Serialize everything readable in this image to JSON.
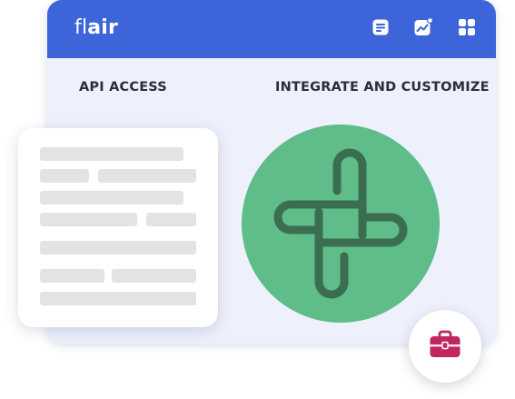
{
  "app": {
    "logo_light": "fl",
    "logo_bold": "air"
  },
  "header": {
    "icons": [
      "document-icon",
      "analytics-icon",
      "apps-grid-icon"
    ],
    "background_color": "#3d65d9"
  },
  "main": {
    "left_title": "API ACCESS",
    "right_title": "INTEGRATE AND CUSTOMIZE",
    "background_color": "#eef0fc"
  },
  "integration": {
    "icon": "integration-cross-icon",
    "circle_color": "#5ebd88",
    "icon_color": "#3b6e50"
  },
  "fab": {
    "icon": "briefcase-icon",
    "icon_color": "#c0265f"
  }
}
